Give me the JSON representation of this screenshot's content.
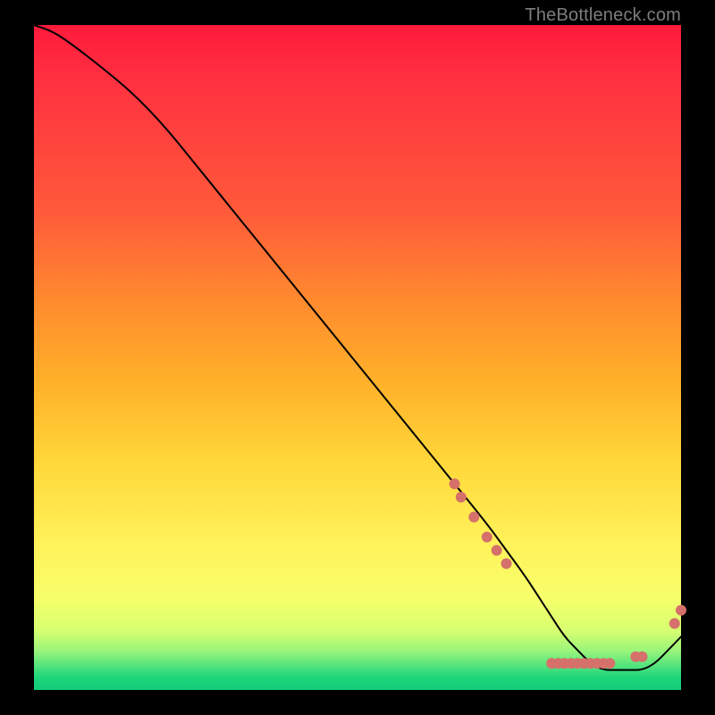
{
  "watermark": "TheBottleneck.com",
  "chart_data": {
    "type": "line",
    "title": "",
    "xlabel": "",
    "ylabel": "",
    "xlim": [
      0,
      100
    ],
    "ylim": [
      0,
      100
    ],
    "grid": false,
    "legend": false,
    "series": [
      {
        "name": "bottleneck-curve",
        "color": "#000000",
        "x": [
          0,
          3,
          6,
          10,
          15,
          20,
          25,
          30,
          35,
          40,
          45,
          50,
          55,
          60,
          65,
          70,
          73,
          76,
          78,
          80,
          82,
          84,
          86,
          88,
          90,
          92,
          94,
          96,
          98,
          100
        ],
        "values": [
          100,
          99,
          97,
          94,
          90,
          85,
          79,
          73,
          67,
          61,
          55,
          49,
          43,
          37,
          31,
          25,
          21,
          17,
          14,
          11,
          8,
          6,
          4,
          3,
          3,
          3,
          3,
          4,
          6,
          8
        ]
      }
    ],
    "markers": [
      {
        "name": "highlight-dots",
        "color": "#d6706a",
        "radius_px": 6,
        "points": [
          {
            "x": 65,
            "y": 31
          },
          {
            "x": 66,
            "y": 29
          },
          {
            "x": 68,
            "y": 26
          },
          {
            "x": 70,
            "y": 23
          },
          {
            "x": 71.5,
            "y": 21
          },
          {
            "x": 73,
            "y": 19
          },
          {
            "x": 80,
            "y": 4
          },
          {
            "x": 81,
            "y": 4
          },
          {
            "x": 82,
            "y": 4
          },
          {
            "x": 83,
            "y": 4
          },
          {
            "x": 84,
            "y": 4
          },
          {
            "x": 85,
            "y": 4
          },
          {
            "x": 86,
            "y": 4
          },
          {
            "x": 87,
            "y": 4
          },
          {
            "x": 88,
            "y": 4
          },
          {
            "x": 89,
            "y": 4
          },
          {
            "x": 93,
            "y": 5
          },
          {
            "x": 94,
            "y": 5
          },
          {
            "x": 99,
            "y": 10
          },
          {
            "x": 100,
            "y": 12
          }
        ]
      }
    ]
  }
}
